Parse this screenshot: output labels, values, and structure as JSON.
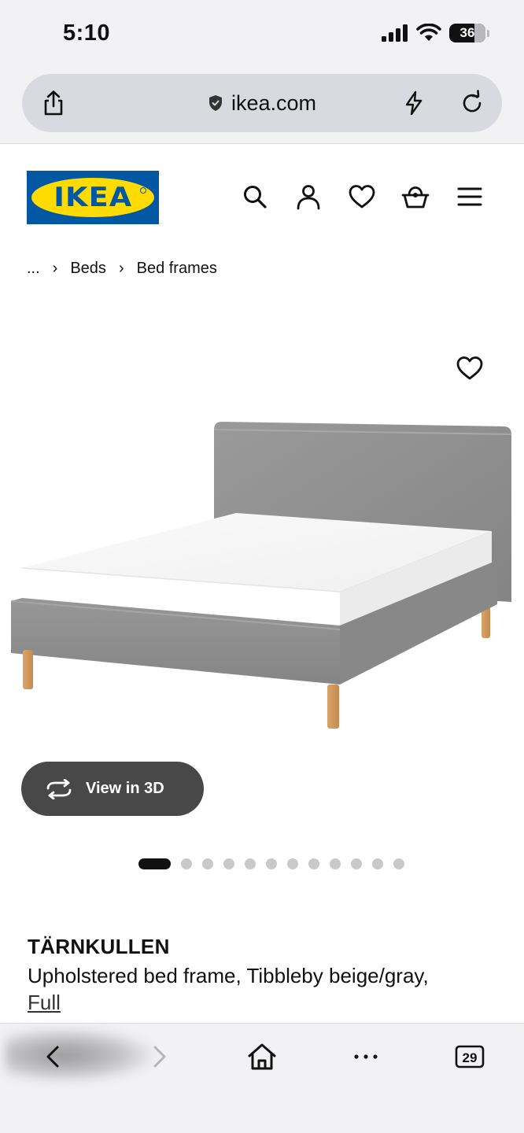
{
  "status_bar": {
    "time": "5:10",
    "battery": "36",
    "icons": [
      "signal-icon",
      "wifi-icon",
      "battery-icon"
    ]
  },
  "browser": {
    "url": "ikea.com",
    "icons": [
      "share-icon",
      "shield-icon",
      "bolt-icon",
      "reload-icon"
    ],
    "tab_count": "29"
  },
  "header": {
    "logo_text": "IKEA",
    "nav_icons": [
      "search-icon",
      "account-icon",
      "heart-icon",
      "basket-icon",
      "menu-icon"
    ]
  },
  "breadcrumb": {
    "items": [
      "...",
      "Beds",
      "Bed frames"
    ]
  },
  "gallery": {
    "view3d_label": "View in 3D",
    "total_images": 12,
    "active_index": 0
  },
  "product": {
    "name": "TÄRNKULLEN",
    "description": "Upholstered bed frame, Tibbleby beige/gray,",
    "size": "Full"
  },
  "colors": {
    "ikea_blue": "#0058a3",
    "ikea_yellow": "#ffdb00",
    "pill_dark": "#484848",
    "fabric_gray": "#8e8e8e"
  }
}
